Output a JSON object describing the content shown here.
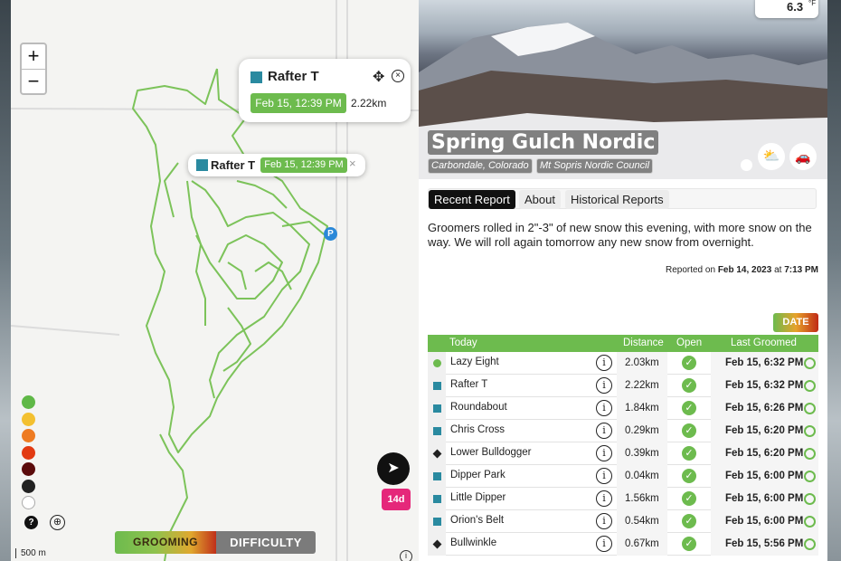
{
  "temperature": "6.3",
  "temperature_unit": "°F",
  "map": {
    "zoom_in": "+",
    "zoom_out": "−",
    "popup1": {
      "name": "Rafter T",
      "date": "Feb 15, 12:39 PM",
      "distance": "2.22km"
    },
    "popup2": {
      "name": "Rafter T",
      "date": "Feb 15, 12:39 PM"
    },
    "scale": "500 m",
    "help_label": "?",
    "parking_label": "P",
    "days_badge": "14d",
    "toggle": {
      "grooming": "GROOMING",
      "difficulty": "DIFFICULTY"
    },
    "legend_colors": [
      "#5fb847",
      "#f3c030",
      "#ee7b22",
      "#e23a12",
      "#5b0b0b",
      "#222222",
      "#ffffff"
    ],
    "trail_color": "#7cc35a"
  },
  "header": {
    "title": "Spring Gulch Nordic",
    "location": "Carbondale, Colorado",
    "organization": "Mt Sopris Nordic Council"
  },
  "tabs": [
    "Recent Report",
    "About",
    "Historical Reports"
  ],
  "report": {
    "text": "Groomers rolled in 2\"-3\" of new snow this evening, with more snow on the way. We will roll again tomorrow any new snow from overnight.",
    "reported_prefix": "Reported on",
    "reported_date": "Feb 14, 2023",
    "reported_at": "at",
    "reported_time": "7:13 PM"
  },
  "date_badge": "DATE",
  "table": {
    "headers": [
      "Today",
      "Distance",
      "Open",
      "Last Groomed"
    ],
    "rows": [
      {
        "icon": "circle",
        "name": "Lazy Eight",
        "distance": "2.03km",
        "last": "Feb 15, 6:32 PM"
      },
      {
        "icon": "square",
        "name": "Rafter T",
        "distance": "2.22km",
        "last": "Feb 15, 6:32 PM"
      },
      {
        "icon": "square",
        "name": "Roundabout",
        "distance": "1.84km",
        "last": "Feb 15, 6:26 PM"
      },
      {
        "icon": "square",
        "name": "Chris Cross",
        "distance": "0.29km",
        "last": "Feb 15, 6:20 PM"
      },
      {
        "icon": "diamond",
        "name": "Lower Bulldogger",
        "distance": "0.39km",
        "last": "Feb 15, 6:20 PM"
      },
      {
        "icon": "square",
        "name": "Dipper Park",
        "distance": "0.04km",
        "last": "Feb 15, 6:00 PM"
      },
      {
        "icon": "square",
        "name": "Little Dipper",
        "distance": "1.56km",
        "last": "Feb 15, 6:00 PM"
      },
      {
        "icon": "square",
        "name": "Orion's Belt",
        "distance": "0.54km",
        "last": "Feb 15, 6:00 PM"
      },
      {
        "icon": "diamond",
        "name": "Bullwinkle",
        "distance": "0.67km",
        "last": "Feb 15, 5:56 PM"
      }
    ]
  }
}
